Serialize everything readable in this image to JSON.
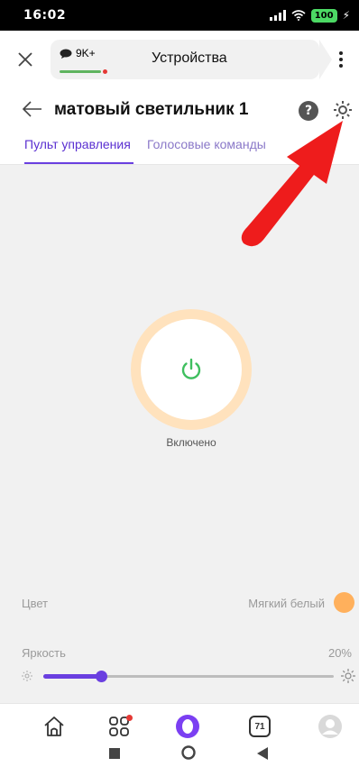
{
  "status_bar": {
    "time": "16:02",
    "battery": "100"
  },
  "browser": {
    "comments_count": "9K+",
    "title": "Устройства"
  },
  "device": {
    "name": "матовый светильник 1",
    "tabs": [
      {
        "label": "Пульт управления",
        "active": true
      },
      {
        "label": "Голосовые команды",
        "active": false
      }
    ]
  },
  "control": {
    "power_status": "Включено",
    "color_label": "Цвет",
    "color_value": "Мягкий белый",
    "color_swatch": "#ffb05c",
    "brightness_label": "Яркость",
    "brightness_value": "20%",
    "brightness_fraction": 0.2
  },
  "bottom_nav": {
    "tabs_count": "71"
  },
  "colors": {
    "accent": "#6a3fe0",
    "power_icon": "#3fbf5f"
  }
}
